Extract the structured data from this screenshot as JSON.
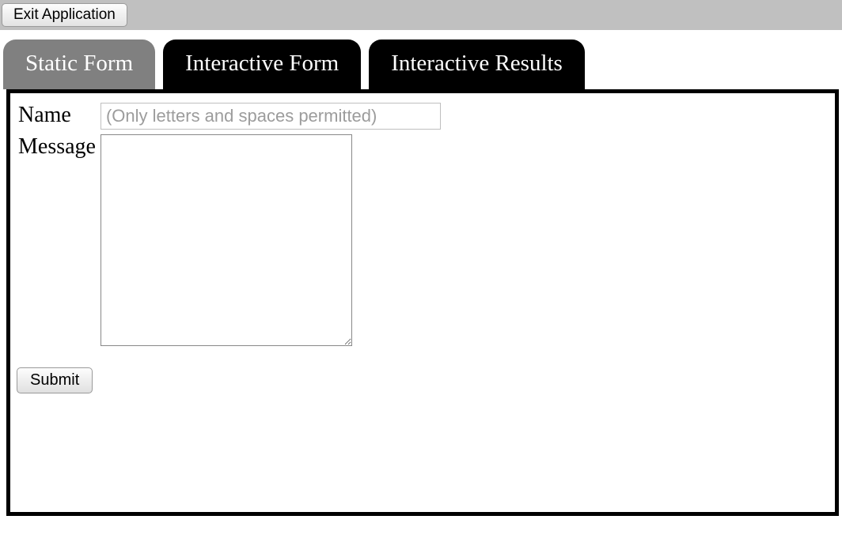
{
  "topbar": {
    "exit_label": "Exit Application"
  },
  "tabs": [
    {
      "label": "Static Form",
      "active": true
    },
    {
      "label": "Interactive Form",
      "active": false
    },
    {
      "label": "Interactive Results",
      "active": false
    }
  ],
  "form": {
    "name_label": "Name",
    "name_placeholder": "(Only letters and spaces permitted)",
    "name_value": "",
    "message_label": "Message",
    "message_value": "",
    "submit_label": "Submit"
  }
}
